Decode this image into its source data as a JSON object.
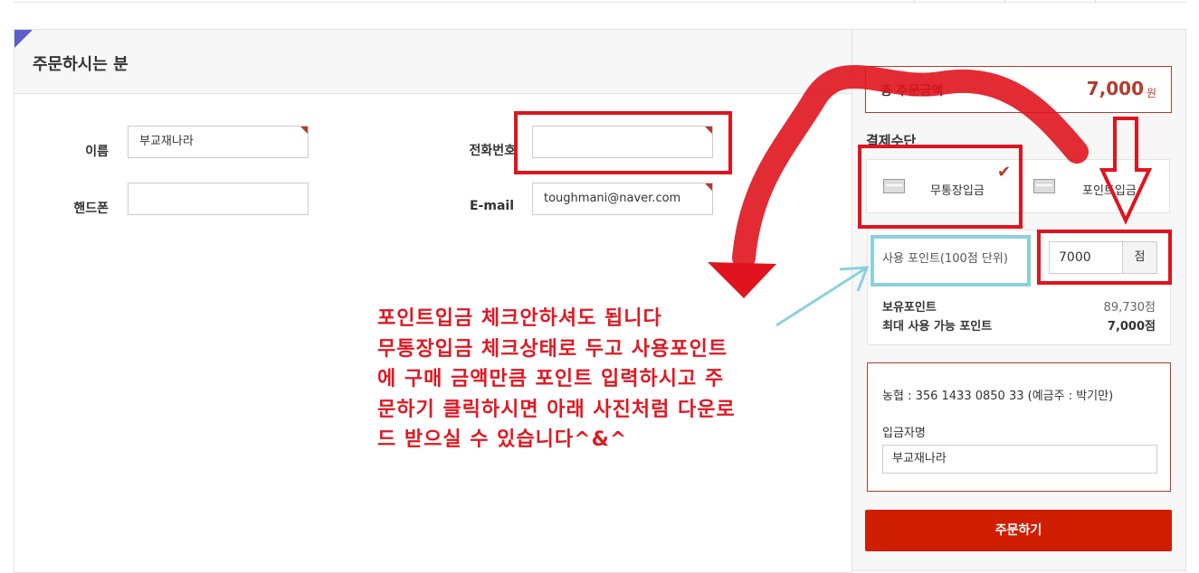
{
  "orderer": {
    "title": "주문하시는 분",
    "name_label": "이름",
    "name_value": "부교재나라",
    "mobile_label": "핸드폰",
    "mobile_value": "",
    "phone_label": "전화번호",
    "phone_value": "",
    "email_label": "E-mail",
    "email_value": "toughmani@naver.com"
  },
  "summary": {
    "total_label": "총 주문금액",
    "total_amount": "7,000",
    "total_unit": "원",
    "payment_label": "결제수단",
    "payment_options": [
      {
        "label": "무통장입금",
        "selected": true
      },
      {
        "label": "포인트입금",
        "selected": false
      }
    ]
  },
  "points": {
    "use_label": "사용 포인트(100점 단위)",
    "use_value": "7000",
    "use_unit": "점",
    "owned_label": "보유포인트",
    "owned_value": "89,730점",
    "max_label": "최대 사용 가능 포인트",
    "max_value": "7,000점"
  },
  "bank": {
    "account_text": "농협 : 356 1433 0850 33 (예금주 : 박기만)",
    "depositor_label": "입금자명",
    "depositor_value": "부교재나라"
  },
  "order_button": "주문하기",
  "annotation": {
    "lines": [
      "포인트입금 체크안하셔도 됩니다",
      "무통장입금 체크상태로 두고 사용포인트",
      "에 구매 금액만큼 포인트 입력하시고 주",
      "문하기 클릭하시면 아래 사진처럼 다운로",
      "드 받으실 수 있습니다^&^"
    ],
    "color": "#e11822"
  },
  "colors": {
    "accent": "#b33b2e",
    "button": "#d01e00",
    "corner": "#5b5fc7"
  }
}
